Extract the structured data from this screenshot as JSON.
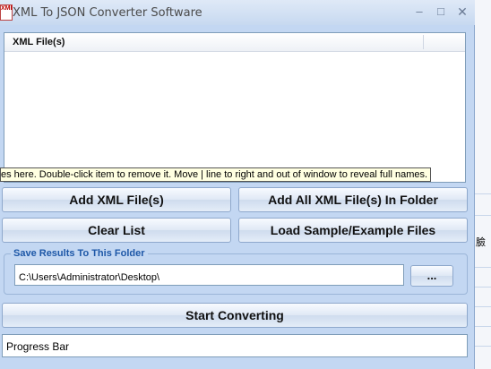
{
  "window": {
    "title": "XML To JSON Converter Software",
    "icon_text": "XML"
  },
  "title_buttons": {
    "minimize": "–",
    "maximize": "□",
    "close": "✕"
  },
  "file_list": {
    "column_header": "XML File(s)",
    "items": []
  },
  "tooltip": {
    "text": "es here. Double-click item to remove it. Move | line to right and out of window to reveal full names."
  },
  "buttons": {
    "add_files": "Add XML File(s)",
    "add_folder": "Add All XML File(s) In Folder",
    "clear_list": "Clear List",
    "load_samples": "Load Sample/Example Files",
    "browse": "...",
    "start": "Start Converting"
  },
  "save_folder": {
    "label": "Save Results To This Folder",
    "path": "C:\\Users\\Administrator\\Desktop\\"
  },
  "progress": {
    "label": "Progress Bar",
    "value": 0
  },
  "background_window": {
    "glyph": "臉"
  }
}
